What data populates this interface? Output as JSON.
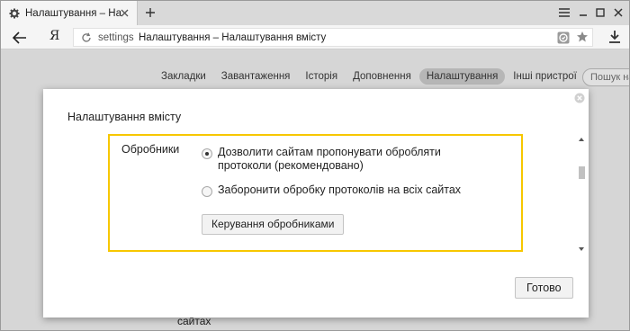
{
  "tab": {
    "title": "Налаштування – Налаштув"
  },
  "address": {
    "scheme": "settings",
    "title": "Налаштування – Налаштування вмісту",
    "logo": "Я"
  },
  "nav": {
    "items": [
      "Закладки",
      "Завантаження",
      "Історія",
      "Доповнення",
      "Налаштування",
      "Інші пристрої"
    ],
    "active_index": 4,
    "search_placeholder": "Пошук на..."
  },
  "behind": {
    "text": "сайтах"
  },
  "dialog": {
    "title": "Налаштування вмісту",
    "section_label": "Обробники",
    "options": [
      {
        "label": "Дозволити сайтам пропонувати обробляти протоколи (рекомендовано)",
        "checked": true
      },
      {
        "label": "Заборонити обробку протоколів на всіх сайтах",
        "checked": false
      }
    ],
    "manage_button": "Керування обробниками",
    "done_button": "Готово"
  },
  "colors": {
    "highlight": "#f7c700"
  }
}
